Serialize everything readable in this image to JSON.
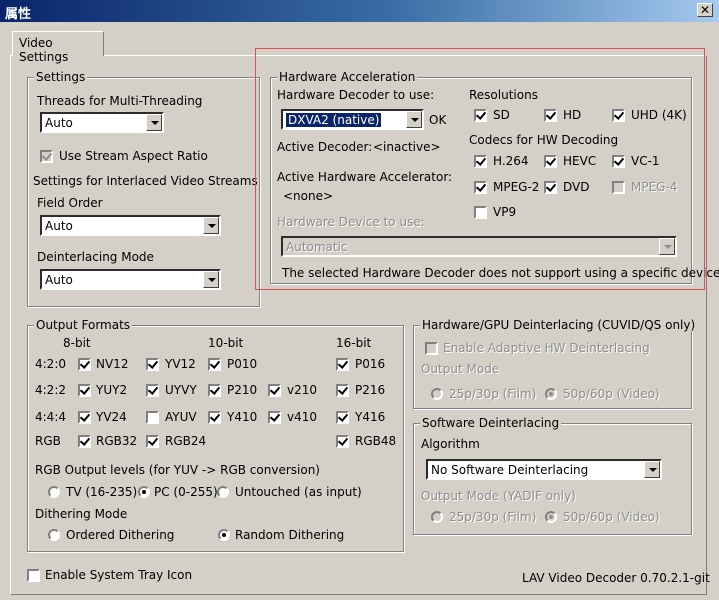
{
  "window": {
    "title": "属性",
    "close": "✕"
  },
  "tabs": [
    {
      "label": "Video Settings"
    }
  ],
  "settings": {
    "legend": "Settings",
    "threads_label": "Threads for Multi-Threading",
    "threads_value": "Auto",
    "aspect_label": "Use Stream Aspect Ratio",
    "interlaced_label": "Settings for Interlaced Video Streams",
    "field_order_label": "Field Order",
    "field_order_value": "Auto",
    "deint_mode_label": "Deinterlacing Mode",
    "deint_mode_value": "Auto"
  },
  "hwaccel": {
    "legend": "Hardware Acceleration",
    "decoder_label": "Hardware Decoder to use:",
    "decoder_value": "DXVA2 (native)",
    "decoder_status": "OK",
    "active_decoder_label": "Active Decoder:",
    "active_decoder_value": "<inactive>",
    "active_accel_label": "Active Hardware Accelerator:",
    "active_accel_value": "<none>",
    "device_label": "Hardware Device to use:",
    "device_value": "Automatic",
    "device_note": "The selected Hardware Decoder does not support using a specific device.",
    "resolutions_label": "Resolutions",
    "resolutions": [
      "SD",
      "HD",
      "UHD (4K)"
    ],
    "codecs_label": "Codecs for HW Decoding",
    "codecs": [
      "H.264",
      "HEVC",
      "VC-1",
      "MPEG-2",
      "DVD",
      "MPEG-4",
      "VP9"
    ]
  },
  "output": {
    "legend": "Output Formats",
    "headers": [
      "8-bit",
      "10-bit",
      "16-bit"
    ],
    "rows": [
      "4:2:0",
      "4:2:2",
      "4:4:4",
      "RGB"
    ],
    "formats": [
      "NV12",
      "YV12",
      "P010",
      "P016",
      "YUY2",
      "UYVY",
      "P210",
      "v210",
      "P216",
      "YV24",
      "AYUV",
      "Y410",
      "v410",
      "Y416",
      "RGB32",
      "RGB24",
      "RGB48"
    ],
    "levels_label": "RGB Output levels (for YUV -> RGB conversion)",
    "levels": [
      "TV (16-235)",
      "PC (0-255)",
      "Untouched (as input)"
    ],
    "dither_label": "Dithering Mode",
    "dither": [
      "Ordered Dithering",
      "Random Dithering"
    ]
  },
  "hwdeint": {
    "legend": "Hardware/GPU Deinterlacing (CUVID/QS only)",
    "enable_label": "Enable Adaptive HW Deinterlacing",
    "mode_label": "Output Mode",
    "modes": [
      "25p/30p (Film)",
      "50p/60p (Video)"
    ]
  },
  "swdeint": {
    "legend": "Software Deinterlacing",
    "algorithm_label": "Algorithm",
    "algorithm_value": "No Software Deinterlacing",
    "mode_label": "Output Mode (YADIF only)",
    "modes": [
      "25p/30p (Film)",
      "50p/60p (Video)"
    ]
  },
  "footer": {
    "tray_label": "Enable System Tray Icon",
    "version": "LAV Video Decoder 0.70.2.1-git"
  }
}
